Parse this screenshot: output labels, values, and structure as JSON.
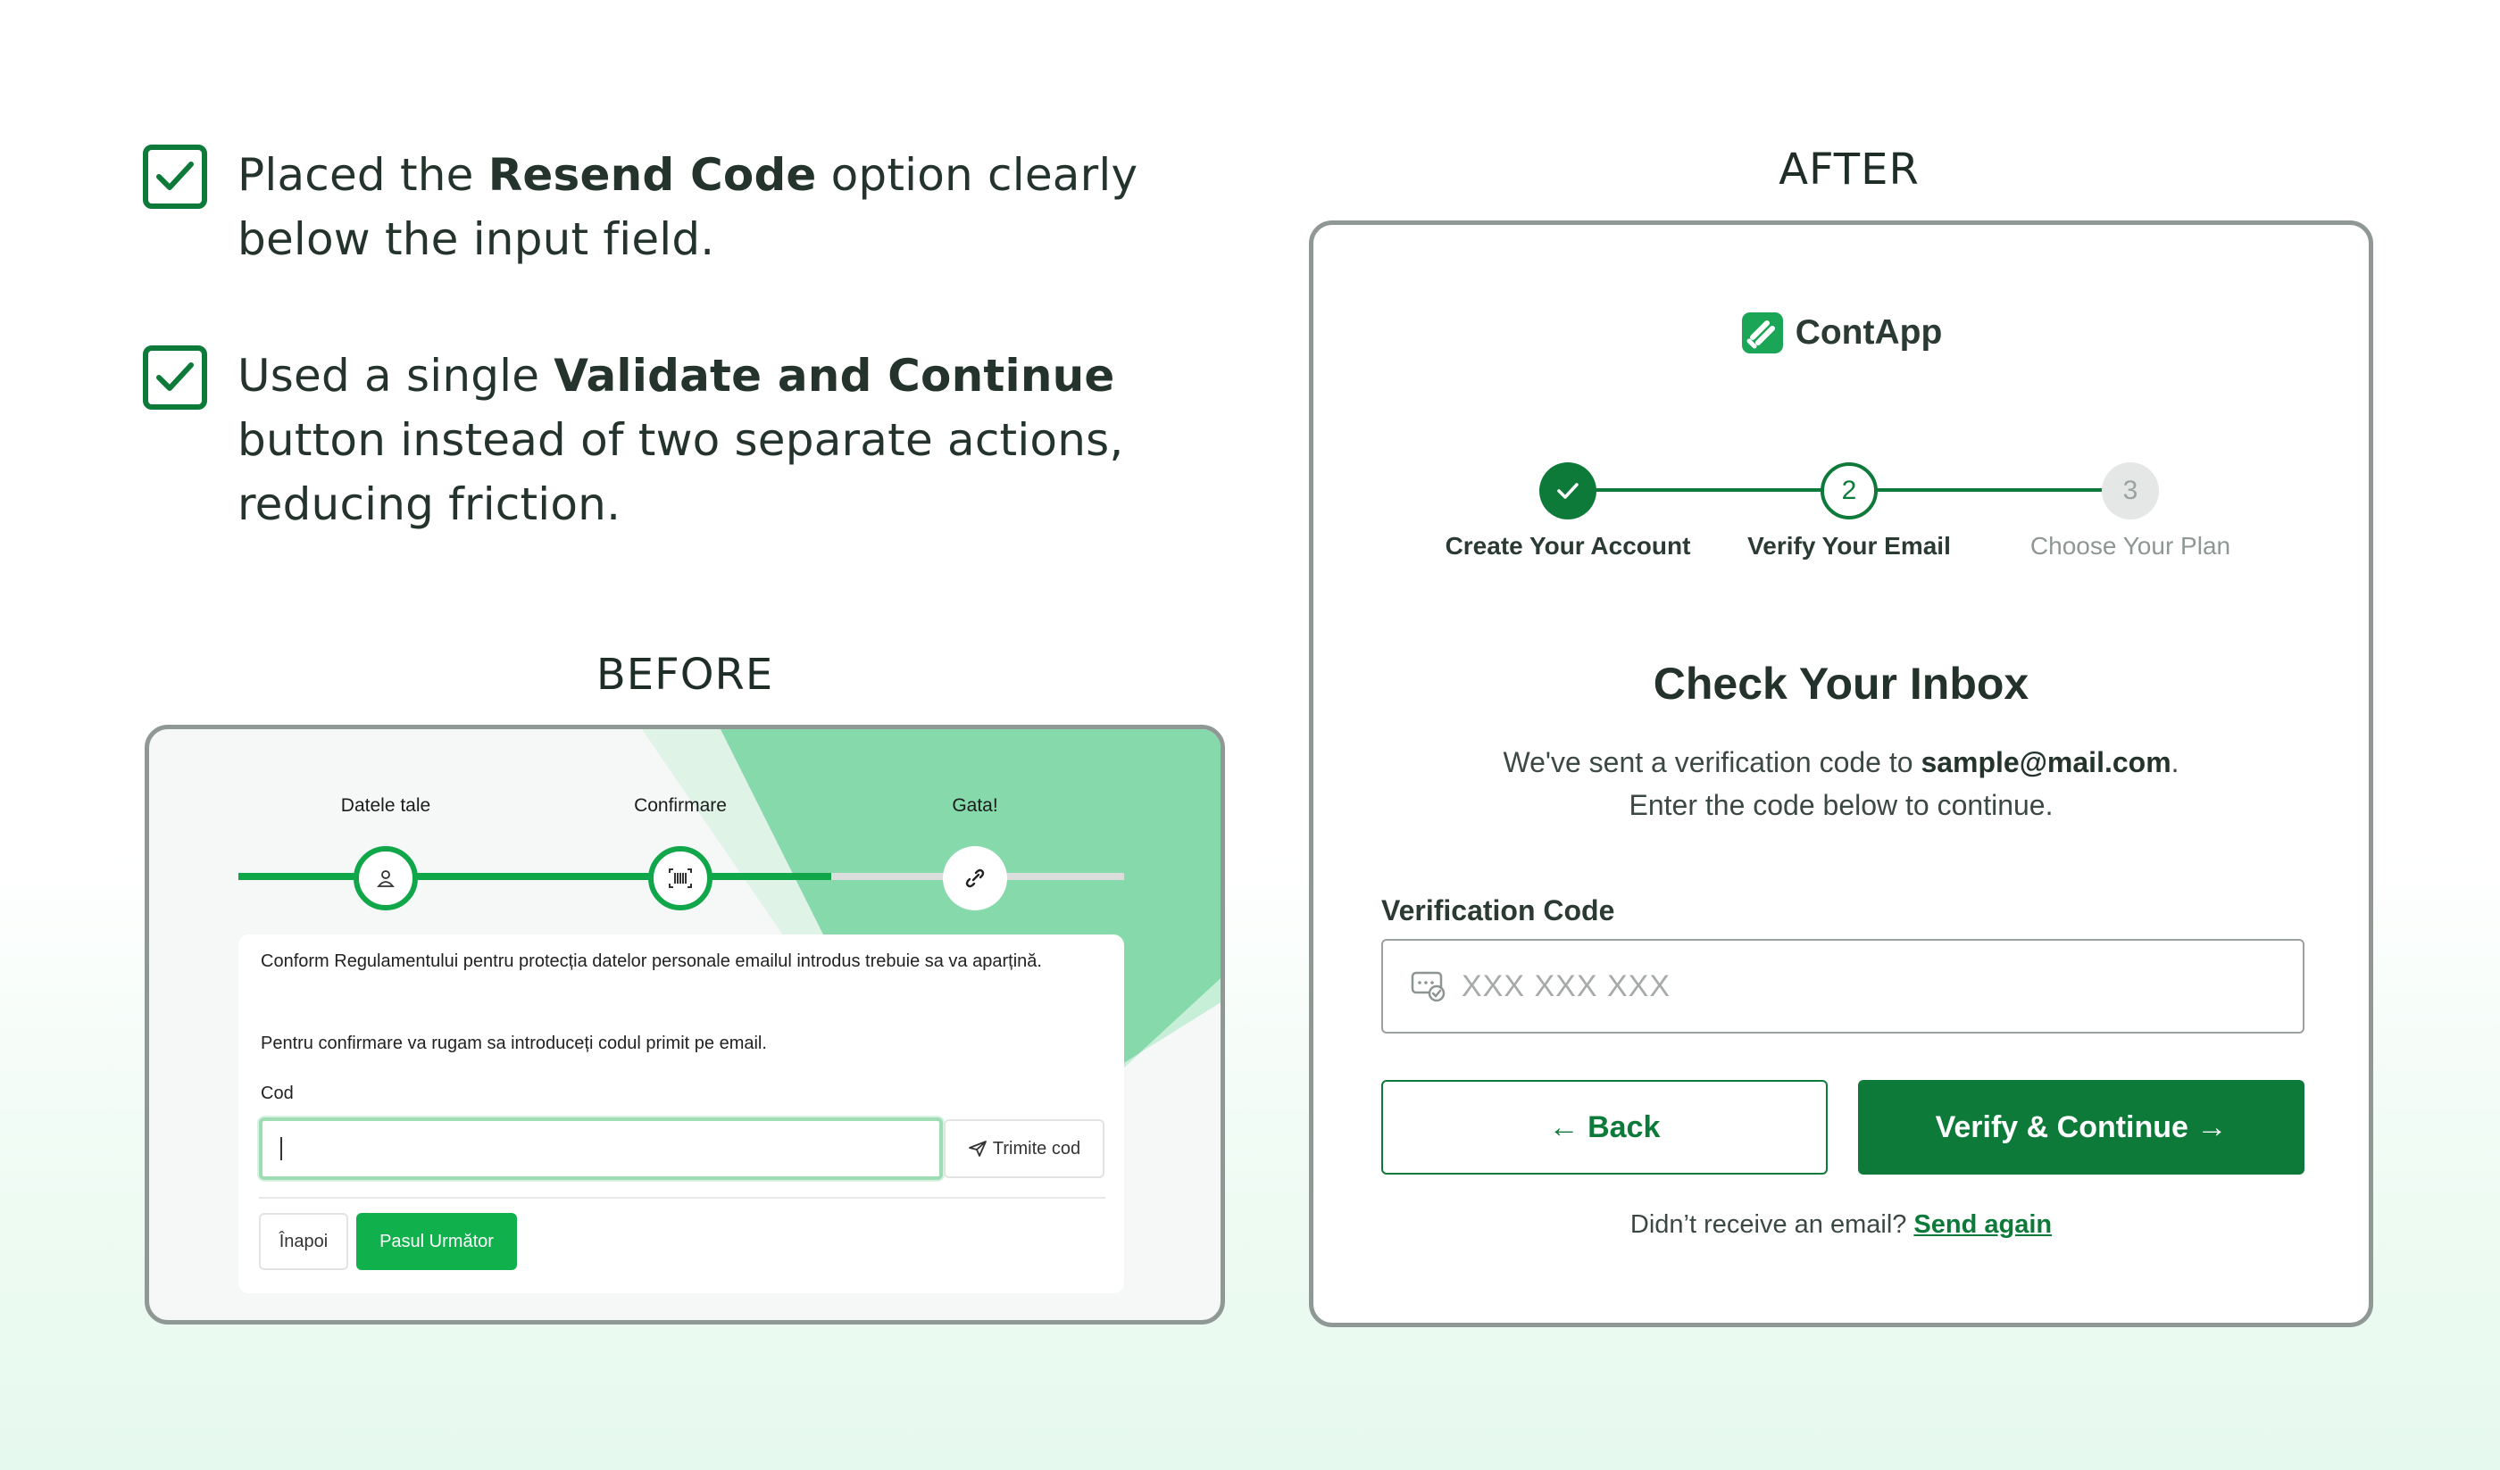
{
  "notes": [
    {
      "pre": "Placed the ",
      "bold": "Resend Code",
      "post": " option clearly below the input field."
    },
    {
      "pre": "Used a single ",
      "bold": "Validate and Continue",
      "post": " button instead of two separate actions, reducing friction."
    }
  ],
  "before": {
    "label": "BEFORE",
    "steps": [
      "Datele tale",
      "Confirmare",
      "Gata!"
    ],
    "progress_fraction": 0.67,
    "paragraph1": "Conform Regulamentului pentru protecția datelor personale emailul introdus trebuie sa va aparțină.",
    "paragraph2": "Pentru confirmare va rugam sa introduceți codul primit pe email.",
    "code_label": "Cod",
    "send_code": "Trimite cod",
    "back": "Înapoi",
    "next": "Pasul Următor",
    "icons": [
      "user-icon",
      "barcode-icon",
      "link-icon",
      "send-icon"
    ]
  },
  "after": {
    "label": "AFTER",
    "brand": "ContApp",
    "steps": [
      {
        "label": "Create Your Account",
        "state": "done",
        "marker": ""
      },
      {
        "label": "Verify Your Email",
        "state": "current",
        "marker": "2"
      },
      {
        "label": "Choose Your Plan",
        "state": "todo",
        "marker": "3"
      }
    ],
    "title": "Check Your Inbox",
    "sub_pre": "We've sent a verification code to ",
    "email": "sample@mail.com",
    "sub_post": ".",
    "sub_line2": "Enter the code below to continue.",
    "field_label": "Verification Code",
    "placeholder": "XXX XXX XXX",
    "back": "Back",
    "verify": "Verify & Continue",
    "resend_text": "Didn’t receive an email?",
    "resend_link": "Send again"
  },
  "colors": {
    "brand_green": "#0e7a3a",
    "before_green": "#10b04c",
    "before_mint": "#86d9aa"
  }
}
